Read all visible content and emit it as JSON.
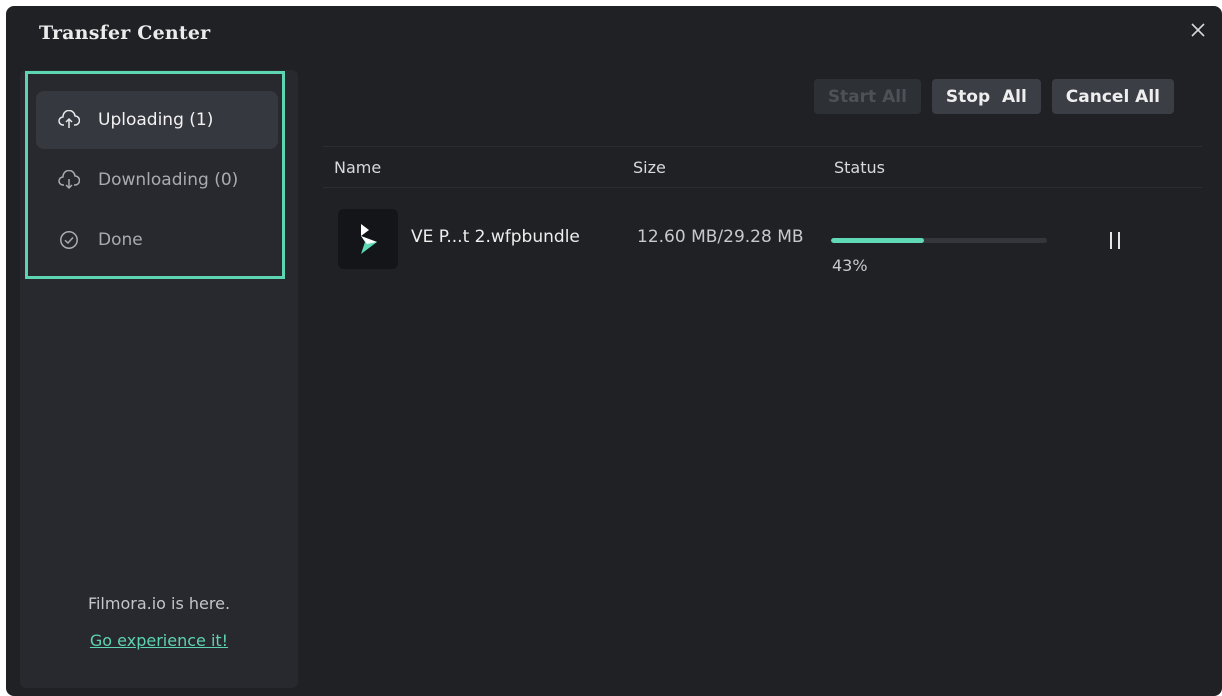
{
  "window": {
    "title": "Transfer Center",
    "close_icon": "close-icon"
  },
  "sidebar": {
    "items": [
      {
        "label": "Uploading (1)",
        "icon": "cloud-upload-icon",
        "active": true
      },
      {
        "label": "Downloading (0)",
        "icon": "cloud-download-icon",
        "active": false
      },
      {
        "label": "Done",
        "icon": "check-circle-icon",
        "active": false
      }
    ],
    "promo_text": "Filmora.io is here.",
    "promo_link": "Go experience it!"
  },
  "toolbar": {
    "start_all": "Start All",
    "stop_all": "Stop  All",
    "cancel_all": "Cancel All"
  },
  "table": {
    "columns": [
      "Name",
      "Size",
      "Status"
    ],
    "rows": [
      {
        "name": "VE P...t 2.wfpbundle",
        "size": "12.60 MB/29.28 MB",
        "progress": 0.43,
        "progress_label": "43%",
        "action_icon": "pause-icon"
      }
    ]
  },
  "colors": {
    "accent": "#5fd9b6",
    "background": "#1f2125",
    "sidebar": "#27292e",
    "highlight_box": "#5cd5b0"
  }
}
